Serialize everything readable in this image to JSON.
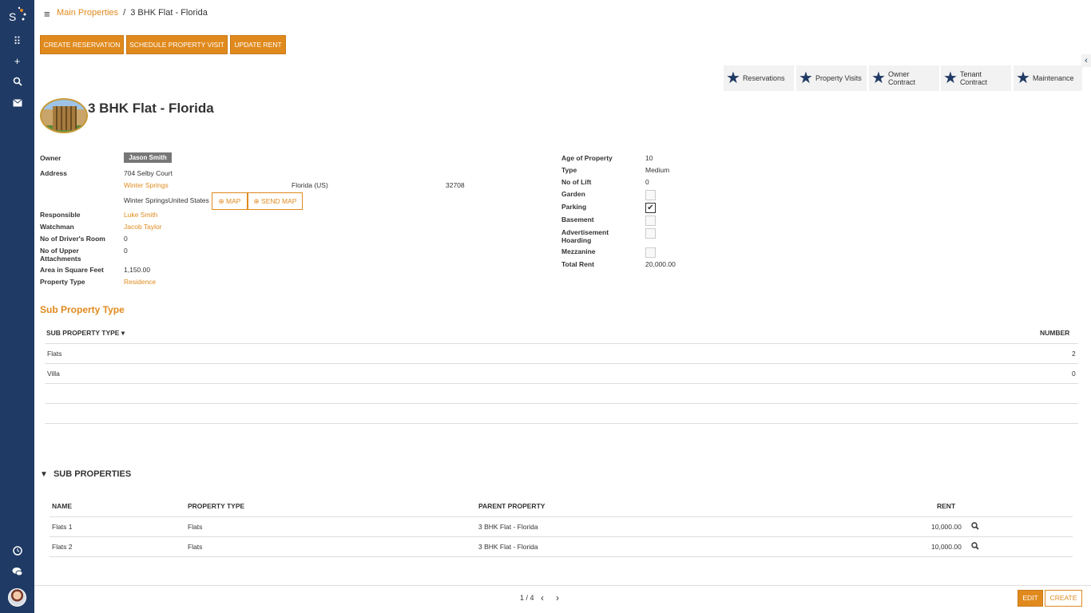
{
  "breadcrumb": {
    "parent": "Main Properties",
    "separator": "/",
    "current": "3 BHK Flat - Florida"
  },
  "actions": {
    "create_reservation": "CREATE RESERVATION",
    "schedule_visit": "SCHEDULE PROPERTY VISIT",
    "update_rent": "UPDATE RENT"
  },
  "smart_buttons": {
    "reservations": "Reservations",
    "property_visits": "Property Visits",
    "owner_contract_1": "Owner",
    "owner_contract_2": "Contract",
    "tenant_contract_1": "Tenant",
    "tenant_contract_2": "Contract",
    "maintenance": "Maintenance"
  },
  "title": "3 BHK Flat - Florida",
  "left_fields": {
    "owner_label": "Owner",
    "owner": "Jason Smith",
    "address_label": "Address",
    "street": "704 Selby Court",
    "city": "Winter Springs",
    "state": "Florida (US)",
    "zip": "32708",
    "address_line": "Winter SpringsUnited States",
    "map_btn": "MAP",
    "send_map_btn": "SEND MAP",
    "responsible_label": "Responsible",
    "responsible": "Luke Smith",
    "watchman_label": "Watchman",
    "watchman": "Jacob Taylor",
    "drivers_room_label": "No of Driver's Room",
    "drivers_room": "0",
    "upper_attach_label_1": "No of Upper",
    "upper_attach_label_2": "Attachments",
    "upper_attach": "0",
    "area_label": "Area in Square Feet",
    "area": "1,150.00",
    "prop_type_label": "Property Type",
    "prop_type": "Residence"
  },
  "right_fields": {
    "age_label": "Age of Property",
    "age": "10",
    "type_label": "Type",
    "type": "Medium",
    "lift_label": "No of Lift",
    "lift": "0",
    "garden_label": "Garden",
    "garden": false,
    "parking_label": "Parking",
    "parking": true,
    "basement_label": "Basement",
    "basement": false,
    "adv_label_1": "Advertisement",
    "adv_label_2": "Hoarding",
    "advertisement": false,
    "mezz_label": "Mezzanine",
    "mezzanine": false,
    "rent_label": "Total Rent",
    "total_rent": "20,000.00"
  },
  "sub_property_type": {
    "section_title": "Sub Property Type",
    "col_type": "SUB PROPERTY TYPE",
    "col_number": "NUMBER",
    "rows": [
      {
        "type": "Flats",
        "number": "2"
      },
      {
        "type": "Villa",
        "number": "0"
      }
    ]
  },
  "sub_properties": {
    "section_title": "SUB PROPERTIES",
    "col_name": "NAME",
    "col_type": "PROPERTY TYPE",
    "col_parent": "PARENT PROPERTY",
    "col_rent": "RENT",
    "rows": [
      {
        "name": "Flats 1",
        "type": "Flats",
        "parent": "3 BHK Flat - Florida",
        "rent": "10,000.00"
      },
      {
        "name": "Flats 2",
        "type": "Flats",
        "parent": "3 BHK Flat - Florida",
        "rent": "10,000.00"
      }
    ]
  },
  "footer": {
    "pager": "1 / 4",
    "edit": "EDIT",
    "create": "CREATE"
  },
  "colors": {
    "brand": "#e08a1e",
    "sidebar": "#1f3a64"
  }
}
